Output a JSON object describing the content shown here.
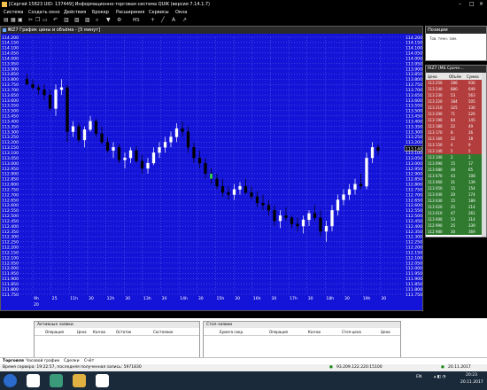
{
  "window": {
    "title": "[Сергей 15823 UID: 137449] Информационно-торговая система QUIK (версия 7.14.1.7)"
  },
  "menu": {
    "items": [
      "Система",
      "Создать окно",
      "Действия",
      "Брокер",
      "Расширения",
      "Сервисы",
      "Окна"
    ]
  },
  "toolbar": {
    "icons": [
      "open-icon",
      "save-icon",
      "print-icon",
      "cut-icon",
      "copy-icon",
      "paste-icon",
      "undo-icon",
      "layout-icon",
      "chart-icon",
      "table-icon",
      "search-icon",
      "filter-icon",
      "settings-icon"
    ],
    "ms_label": "MS",
    "cursor_symbol": "+"
  },
  "chart_window": {
    "title": "RIZ7 График цены и объёма - [5 минут]",
    "background": "#1414d8"
  },
  "chart_data": {
    "type": "candlestick",
    "ylim": [
      111750,
      114200
    ],
    "y_ticks": [
      "114.200",
      "114.150",
      "114.100",
      "114.050",
      "114.000",
      "113.950",
      "113.900",
      "113.850",
      "113.800",
      "113.750",
      "113.700",
      "113.650",
      "113.600",
      "113.550",
      "113.500",
      "113.450",
      "113.400",
      "113.350",
      "113.300",
      "113.250",
      "113.200",
      "113.150",
      "113.100",
      "113.050",
      "113.000",
      "112.950",
      "112.900",
      "112.850",
      "112.800",
      "112.750",
      "112.700",
      "112.650",
      "112.600",
      "112.550",
      "112.500",
      "112.450",
      "112.400",
      "112.350",
      "112.300",
      "112.250",
      "112.200",
      "112.150",
      "112.100",
      "112.050",
      "112.000",
      "111.950",
      "111.900",
      "111.850",
      "111.800",
      "111.750"
    ],
    "x_labels_top": [
      "9h",
      "25",
      "11h",
      "30",
      "12h",
      "30",
      "13h",
      "30",
      "14h",
      "30",
      "15h",
      "30",
      "16h",
      "30",
      "17h",
      "30",
      "18h",
      "30",
      "19h",
      "30"
    ],
    "x_label_bottom": "20",
    "price_marker": "113.140",
    "candles": [
      {
        "o": 113800,
        "h": 113850,
        "l": 113750,
        "c": 113750
      },
      {
        "o": 113750,
        "h": 113800,
        "l": 113700,
        "c": 113720
      },
      {
        "o": 113720,
        "h": 113750,
        "l": 113650,
        "c": 113700
      },
      {
        "o": 113700,
        "h": 113750,
        "l": 113600,
        "c": 113650
      },
      {
        "o": 113650,
        "h": 113700,
        "l": 113500,
        "c": 113520
      },
      {
        "o": 113520,
        "h": 113750,
        "l": 113450,
        "c": 113700
      },
      {
        "o": 113700,
        "h": 113800,
        "l": 113650,
        "c": 113720
      },
      {
        "o": 113720,
        "h": 113750,
        "l": 113200,
        "c": 113300
      },
      {
        "o": 113300,
        "h": 113400,
        "l": 113250,
        "c": 113350
      },
      {
        "o": 113350,
        "h": 113380,
        "l": 113200,
        "c": 113220
      },
      {
        "o": 113220,
        "h": 113350,
        "l": 113150,
        "c": 113320
      },
      {
        "o": 113320,
        "h": 113450,
        "l": 113300,
        "c": 113400
      },
      {
        "o": 113400,
        "h": 113420,
        "l": 113250,
        "c": 113280
      },
      {
        "o": 113280,
        "h": 113350,
        "l": 113180,
        "c": 113200
      },
      {
        "o": 113200,
        "h": 113250,
        "l": 113100,
        "c": 113120
      },
      {
        "o": 113120,
        "h": 113200,
        "l": 113050,
        "c": 113150
      },
      {
        "o": 113150,
        "h": 113180,
        "l": 113000,
        "c": 113030
      },
      {
        "o": 113030,
        "h": 113100,
        "l": 112950,
        "c": 113050
      },
      {
        "o": 113050,
        "h": 113150,
        "l": 113000,
        "c": 113120
      },
      {
        "o": 113120,
        "h": 113160,
        "l": 113000,
        "c": 113020
      },
      {
        "o": 113020,
        "h": 113080,
        "l": 112900,
        "c": 112950
      },
      {
        "o": 112950,
        "h": 113050,
        "l": 112900,
        "c": 113000
      },
      {
        "o": 113000,
        "h": 113150,
        "l": 112980,
        "c": 113100
      },
      {
        "o": 113100,
        "h": 113200,
        "l": 113050,
        "c": 113150
      },
      {
        "o": 113150,
        "h": 113250,
        "l": 113100,
        "c": 113200
      },
      {
        "o": 113200,
        "h": 113300,
        "l": 113150,
        "c": 113250
      },
      {
        "o": 113250,
        "h": 113380,
        "l": 113200,
        "c": 113330
      },
      {
        "o": 113330,
        "h": 113400,
        "l": 113250,
        "c": 113300
      },
      {
        "o": 113300,
        "h": 113350,
        "l": 113100,
        "c": 113150
      },
      {
        "o": 113150,
        "h": 113200,
        "l": 113000,
        "c": 113050
      },
      {
        "o": 113050,
        "h": 113120,
        "l": 112950,
        "c": 113000
      },
      {
        "o": 113000,
        "h": 113050,
        "l": 112850,
        "c": 112900
      },
      {
        "o": 112900,
        "h": 112950,
        "l": 112800,
        "c": 112850
      },
      {
        "o": 112850,
        "h": 112900,
        "l": 112750,
        "c": 112780
      },
      {
        "o": 112780,
        "h": 112850,
        "l": 112680,
        "c": 112720
      },
      {
        "o": 112720,
        "h": 112780,
        "l": 112650,
        "c": 112700
      },
      {
        "o": 112700,
        "h": 112800,
        "l": 112650,
        "c": 112750
      },
      {
        "o": 112750,
        "h": 112820,
        "l": 112700,
        "c": 112780
      },
      {
        "o": 112780,
        "h": 112850,
        "l": 112700,
        "c": 112720
      },
      {
        "o": 112720,
        "h": 112780,
        "l": 112650,
        "c": 112680
      },
      {
        "o": 112680,
        "h": 112730,
        "l": 112580,
        "c": 112620
      },
      {
        "o": 112620,
        "h": 112700,
        "l": 112550,
        "c": 112600
      },
      {
        "o": 112600,
        "h": 112650,
        "l": 112500,
        "c": 112550
      },
      {
        "o": 112550,
        "h": 112600,
        "l": 112400,
        "c": 112450
      },
      {
        "o": 112450,
        "h": 112550,
        "l": 112380,
        "c": 112500
      },
      {
        "o": 112500,
        "h": 112580,
        "l": 112450,
        "c": 112480
      },
      {
        "o": 112480,
        "h": 112500,
        "l": 112380,
        "c": 112420
      },
      {
        "o": 112420,
        "h": 112480,
        "l": 112350,
        "c": 112400
      },
      {
        "o": 112400,
        "h": 112500,
        "l": 112330,
        "c": 112460
      },
      {
        "o": 112460,
        "h": 112550,
        "l": 112400,
        "c": 112520
      },
      {
        "o": 112520,
        "h": 112600,
        "l": 112450,
        "c": 112480
      },
      {
        "o": 112480,
        "h": 112550,
        "l": 112300,
        "c": 112350
      },
      {
        "o": 112350,
        "h": 112450,
        "l": 112250,
        "c": 112400
      },
      {
        "o": 112400,
        "h": 112600,
        "l": 112350,
        "c": 112550
      },
      {
        "o": 112550,
        "h": 112700,
        "l": 112500,
        "c": 112650
      },
      {
        "o": 112650,
        "h": 112750,
        "l": 112600,
        "c": 112700
      },
      {
        "o": 112700,
        "h": 112800,
        "l": 112650,
        "c": 112750
      },
      {
        "o": 112750,
        "h": 112850,
        "l": 112700,
        "c": 112800
      },
      {
        "o": 112800,
        "h": 112900,
        "l": 112750,
        "c": 112780
      },
      {
        "o": 112780,
        "h": 113100,
        "l": 112750,
        "c": 113050
      },
      {
        "o": 113050,
        "h": 113200,
        "l": 113000,
        "c": 113150
      },
      {
        "o": 113150,
        "h": 113180,
        "l": 113080,
        "c": 113120
      }
    ],
    "green_highlight_index": 32
  },
  "positions": {
    "title": "Позиции",
    "empty_text": "Тов. тенн. зам."
  },
  "glass": {
    "title": "RIZ7 (МБ Срочн...",
    "col1": "Цена",
    "col2": "Объём",
    "col3": "Сумма",
    "sell_rows": [
      [
        "113 250",
        "286",
        "936"
      ],
      [
        "113 240",
        "880",
        "649"
      ],
      [
        "113 230",
        "53",
        "563"
      ],
      [
        "113 220",
        "184",
        "505"
      ],
      [
        "113 210",
        "325",
        "336"
      ],
      [
        "113 200",
        "71",
        "226"
      ],
      [
        "113 190",
        "84",
        "145"
      ],
      [
        "113 180",
        "22",
        "49"
      ],
      [
        "113 170",
        "8",
        "26"
      ],
      [
        "113 160",
        "22",
        "18"
      ],
      [
        "113 150",
        "4",
        "9"
      ],
      [
        "113 140",
        "5",
        "5"
      ]
    ],
    "buy_rows": [
      [
        "113 100",
        "2",
        "2"
      ],
      [
        "113 090",
        "15",
        "17"
      ],
      [
        "113 080",
        "48",
        "65"
      ],
      [
        "113 070",
        "43",
        "108"
      ],
      [
        "113 060",
        "31",
        "139"
      ],
      [
        "113 050",
        "15",
        "154"
      ],
      [
        "113 040",
        "20",
        "174"
      ],
      [
        "113 030",
        "15",
        "189"
      ],
      [
        "113 020",
        "25",
        "214"
      ],
      [
        "113 010",
        "47",
        "261"
      ],
      [
        "113 000",
        "53",
        "314"
      ],
      [
        "112 990",
        "25",
        "339"
      ],
      [
        "112 980",
        "30",
        "369"
      ]
    ]
  },
  "orders_panel": {
    "title": "Активные заявки",
    "columns": [
      "Операция",
      "Цена",
      "Кол-во",
      "Остаток",
      "Состояние"
    ]
  },
  "stops_panel": {
    "title": "Стоп-заявки",
    "columns": [
      "Бумага сокр.",
      "Операция",
      "Кол-во",
      "Стоп-цена",
      "Цена"
    ]
  },
  "tabs": [
    "Торговля",
    "Часовой график",
    "Сделки",
    "Счёт"
  ],
  "status": {
    "server_time": "Время сервера: 19:22:57, последняя полученная запись: 5971830",
    "connection": "93.209.122.220:15100",
    "date": "20.11.2017"
  },
  "taskbar": {
    "lang": "EN",
    "time": "20:23",
    "date": "20.11.2017"
  }
}
